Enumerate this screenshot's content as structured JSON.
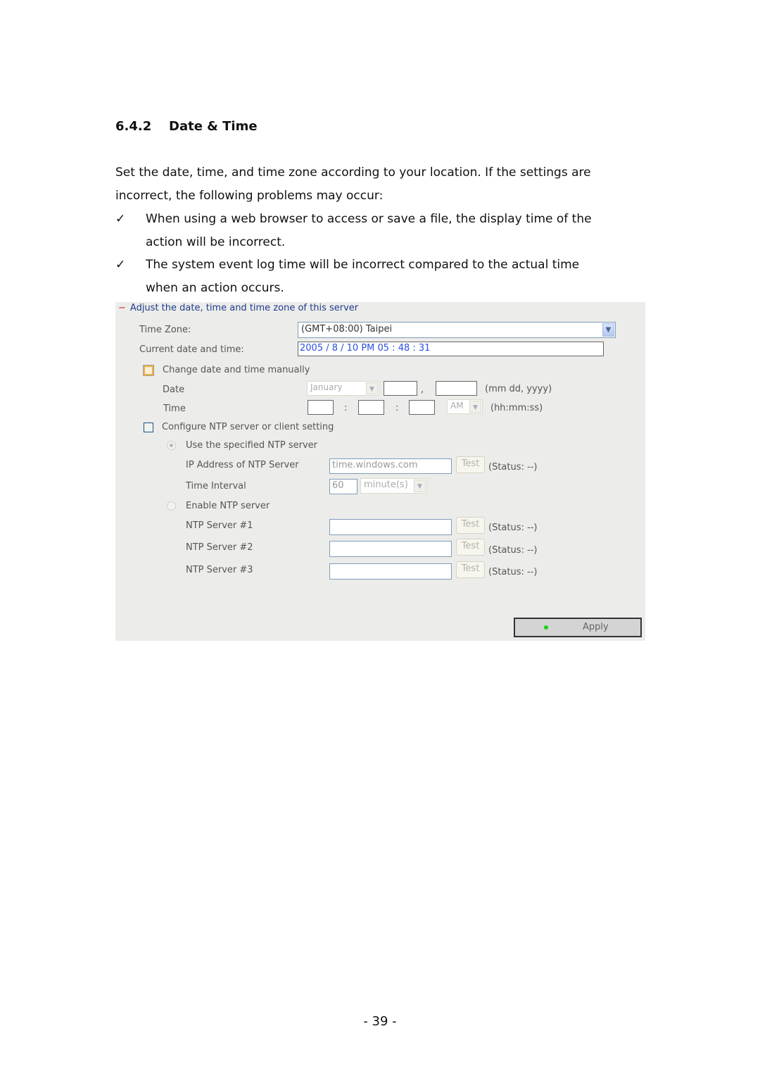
{
  "section": {
    "number": "6.4.2",
    "title": "Date & Time"
  },
  "intro": {
    "line1": "Set the date, time, and time zone according to your location.  If the settings are",
    "line2": "incorrect, the following problems may occur:"
  },
  "bullets": [
    {
      "icon": "check-icon",
      "glyph": "✓",
      "line1": "When using a web browser to access or save a file, the display time of the",
      "line2": "action will be incorrect."
    },
    {
      "icon": "check-icon",
      "glyph": "✓",
      "line1": "The system event log time will be incorrect compared to the actual time",
      "line2": "when an action occurs."
    }
  ],
  "panel": {
    "header_icon": "collapse-minus-icon",
    "header_glyph": "−",
    "header": "Adjust the date, time and time zone of this server",
    "time_zone_label": "Time Zone:",
    "time_zone_value": "(GMT+08:00) Taipei",
    "current_label": "Current date and time:",
    "current_value": "2005 / 8 / 10 PM 05 : 48 : 31",
    "manual": {
      "label": "Change date and time manually",
      "checked": false,
      "date_label": "Date",
      "month_value": "January",
      "date_comma": ",",
      "date_hint": "(mm dd, yyyy)",
      "time_label": "Time",
      "time_sep": ":",
      "ampm_value": "AM",
      "time_hint": "(hh:mm:ss)"
    },
    "ntp": {
      "label": "Configure NTP server or client setting",
      "checked": false,
      "use_specified_label": "Use the specified NTP server",
      "ip_label": "IP Address of NTP Server",
      "ip_value": "time.windows.com",
      "interval_label": "Time Interval",
      "interval_value": "60",
      "interval_unit": "minute(s)",
      "enable_server_label": "Enable NTP server",
      "servers": [
        {
          "label": "NTP Server #1",
          "value": "",
          "status": "(Status: --)"
        },
        {
          "label": "NTP Server #2",
          "value": "",
          "status": "(Status: --)"
        },
        {
          "label": "NTP Server #3",
          "value": "",
          "status": "(Status: --)"
        }
      ],
      "ip_status": "(Status: --)",
      "test_label": "Test"
    },
    "apply_label": "Apply",
    "apply_led_color": "#1bd41b",
    "accent_color": "#1f3d8f"
  },
  "page_number": "- 39 -"
}
